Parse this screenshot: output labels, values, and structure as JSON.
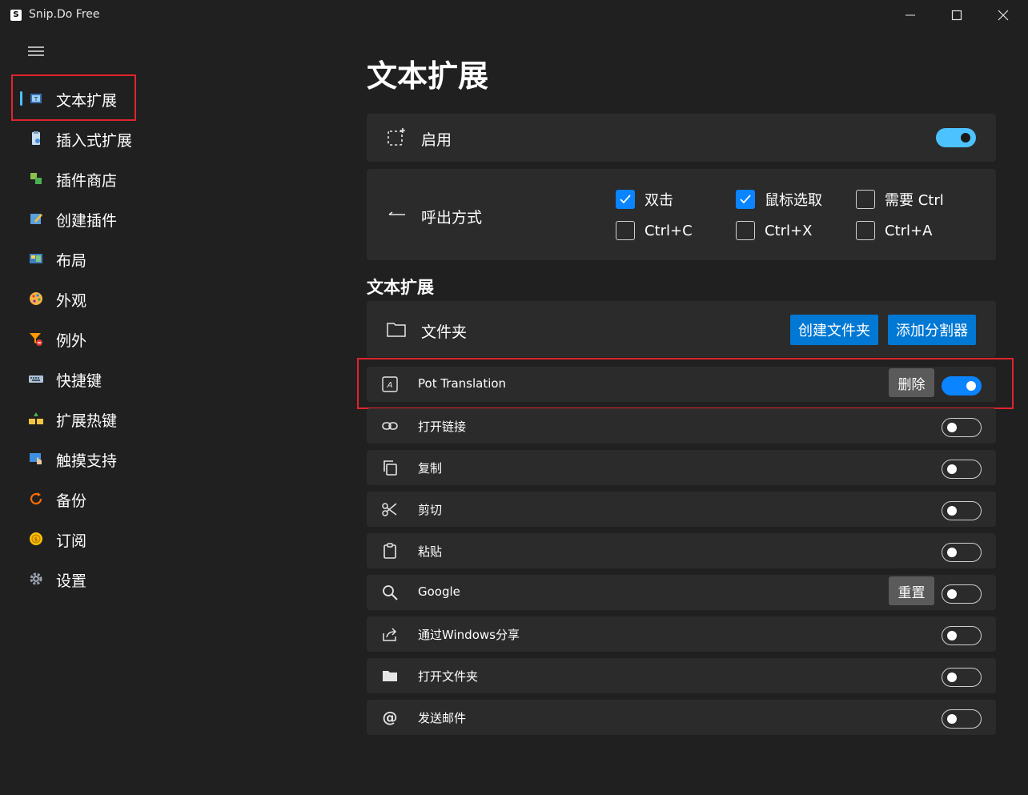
{
  "window": {
    "title": "Snip.Do Free",
    "logo_letter": "S"
  },
  "sidebar": {
    "items": [
      {
        "label": "文本扩展",
        "icon": "text-extension-icon",
        "selected": true
      },
      {
        "label": "插入式扩展",
        "icon": "insert-extension-icon"
      },
      {
        "label": "插件商店",
        "icon": "plugin-store-icon"
      },
      {
        "label": "创建插件",
        "icon": "create-plugin-icon"
      },
      {
        "label": "布局",
        "icon": "layout-icon"
      },
      {
        "label": "外观",
        "icon": "palette-icon"
      },
      {
        "label": "例外",
        "icon": "filter-exception-icon"
      },
      {
        "label": "快捷键",
        "icon": "keyboard-icon"
      },
      {
        "label": "扩展热键",
        "icon": "hotkey-icon"
      },
      {
        "label": "触摸支持",
        "icon": "touch-icon"
      },
      {
        "label": "备份",
        "icon": "backup-icon"
      },
      {
        "label": "订阅",
        "icon": "subscription-icon"
      },
      {
        "label": "设置",
        "icon": "gear-icon"
      }
    ]
  },
  "main": {
    "title": "文本扩展",
    "enable": {
      "label": "启用",
      "on": true
    },
    "trigger": {
      "label": "呼出方式",
      "options": [
        {
          "label": "双击",
          "checked": true
        },
        {
          "label": "鼠标选取",
          "checked": true
        },
        {
          "label": "需要 Ctrl",
          "checked": false
        },
        {
          "label": "Ctrl+C",
          "checked": false
        },
        {
          "label": "Ctrl+X",
          "checked": false
        },
        {
          "label": "Ctrl+A",
          "checked": false
        }
      ]
    },
    "section_title": "文本扩展",
    "folder": {
      "label": "文件夹",
      "create_folder_btn": "创建文件夹",
      "add_separator_btn": "添加分割器"
    },
    "extensions": [
      {
        "label": "Pot Translation",
        "icon": "translate-icon",
        "on": true,
        "action": "删除"
      },
      {
        "label": "打开链接",
        "icon": "link-icon",
        "on": false
      },
      {
        "label": "复制",
        "icon": "copy-icon",
        "on": false
      },
      {
        "label": "剪切",
        "icon": "scissors-icon",
        "on": false
      },
      {
        "label": "粘贴",
        "icon": "clipboard-icon",
        "on": false
      },
      {
        "label": "Google",
        "icon": "search-icon",
        "on": false,
        "action": "重置"
      },
      {
        "label": "通过Windows分享",
        "icon": "share-icon",
        "on": false
      },
      {
        "label": "打开文件夹",
        "icon": "folder-icon",
        "on": false
      },
      {
        "label": "发送邮件",
        "icon": "at-icon",
        "on": false
      }
    ]
  },
  "colors": {
    "background": "#202020",
    "card": "#2b2b2b",
    "accent": "#0a84ff",
    "button_blue": "#0078d4",
    "highlight": "#e0242c"
  }
}
